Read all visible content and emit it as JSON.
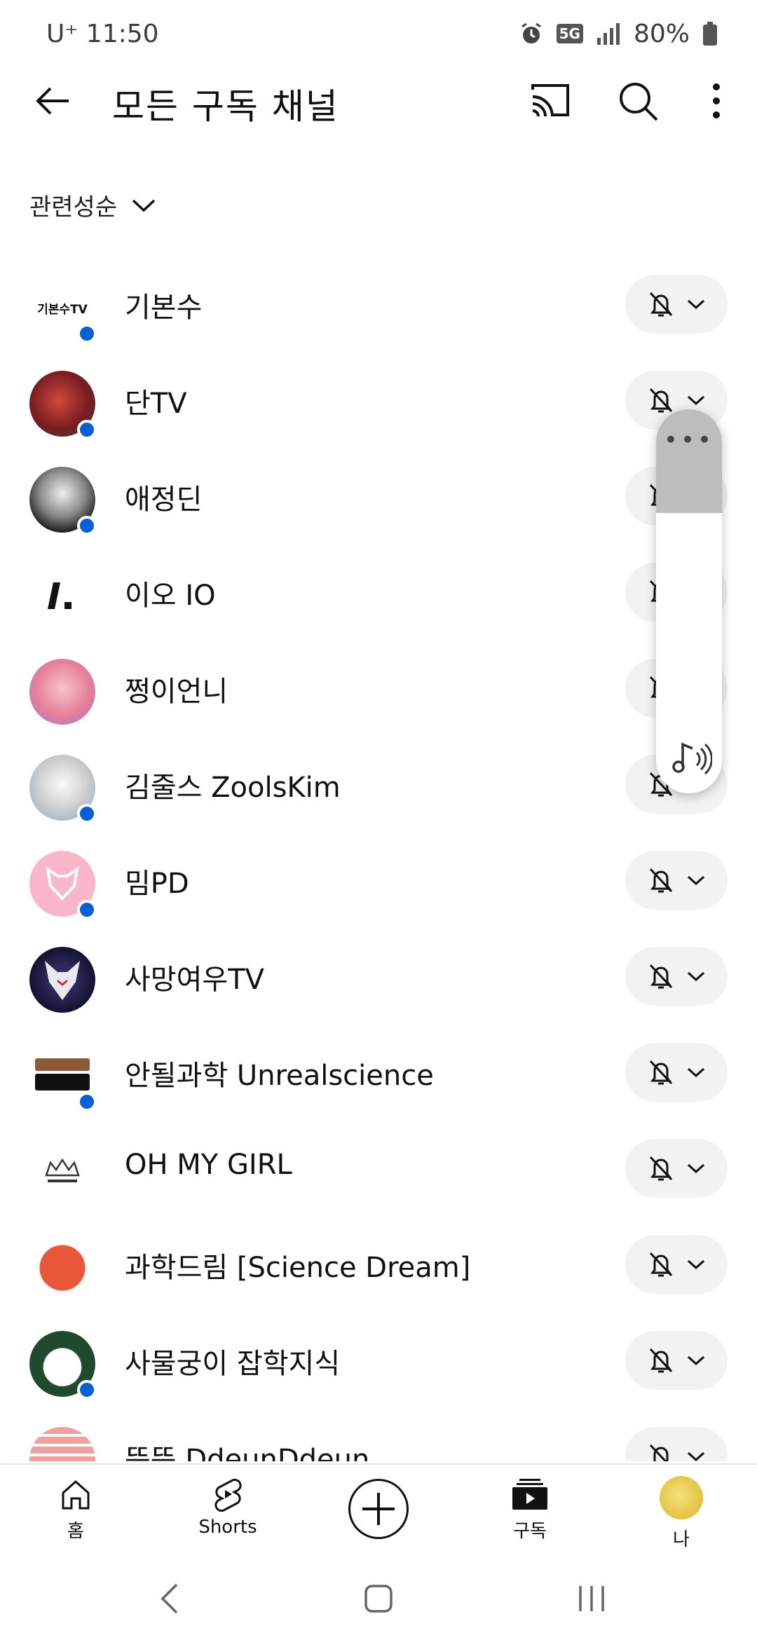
{
  "status_bar": {
    "carrier_time": "U⁺ 11:50",
    "network": "5G",
    "battery": "80%"
  },
  "app_bar": {
    "title": "모든 구독 채널"
  },
  "sort": {
    "label": "관련성순"
  },
  "channels": [
    {
      "name": "기본수",
      "avatar": "기본수TV",
      "new": true
    },
    {
      "name": "단TV",
      "new": true
    },
    {
      "name": "애정딘",
      "new": true
    },
    {
      "name": "이오 IO",
      "new": false
    },
    {
      "name": "쩡이언니",
      "new": false
    },
    {
      "name": "김줄스 ZoolsKim",
      "new": true
    },
    {
      "name": "밈PD",
      "new": true
    },
    {
      "name": "사망여우TV",
      "new": false
    },
    {
      "name": "안될과학 Unrealscience",
      "new": true
    },
    {
      "name": "OH MY GIRL",
      "new": false
    },
    {
      "name": "과학드림 [Science Dream]",
      "new": false
    },
    {
      "name": "사물궁이 잡학지식",
      "new": true
    },
    {
      "name": "뜬뜬 DdeunDdeun",
      "new": false
    }
  ],
  "volume_panel": {
    "level_percent": 27
  },
  "bottom_nav": {
    "home": "홈",
    "shorts": "Shorts",
    "subscriptions": "구독",
    "you": "나"
  },
  "colors": {
    "accent_dot": "#065fd4",
    "pill_bg": "#f2f2f2"
  }
}
